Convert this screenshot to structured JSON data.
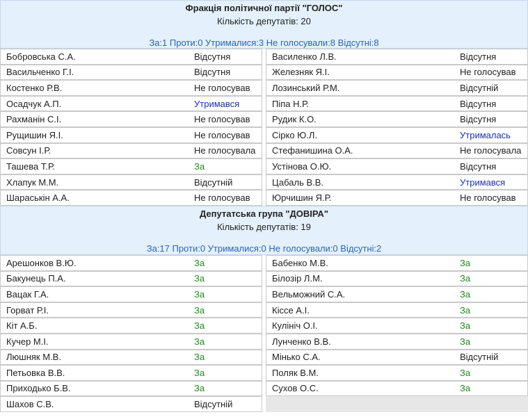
{
  "sections": [
    {
      "title": "Фракція політичної партії \"ГОЛОС\"",
      "count": "Кількість депутатів: 20",
      "summary": "За:1 Проти:0 Утрималися:3 Не голосували:8 Відсутні:8",
      "rows": [
        [
          {
            "name": "Бобровська С.А.",
            "status": "Відсутня",
            "kind": "other"
          },
          {
            "name": "Василенко Л.В.",
            "status": "Відсутня",
            "kind": "other"
          }
        ],
        [
          {
            "name": "Васильченко Г.І.",
            "status": "Відсутня",
            "kind": "other"
          },
          {
            "name": "Железняк Я.І.",
            "status": "Не голосував",
            "kind": "other"
          }
        ],
        [
          {
            "name": "Костенко Р.В.",
            "status": "Не голосував",
            "kind": "other"
          },
          {
            "name": "Лозинський Р.М.",
            "status": "Відсутній",
            "kind": "other"
          }
        ],
        [
          {
            "name": "Осадчук А.П.",
            "status": "Утримався",
            "kind": "utr"
          },
          {
            "name": "Піпа Н.Р.",
            "status": "Відсутня",
            "kind": "other"
          }
        ],
        [
          {
            "name": "Рахманін С.І.",
            "status": "Не голосував",
            "kind": "other"
          },
          {
            "name": "Рудик К.О.",
            "status": "Відсутня",
            "kind": "other"
          }
        ],
        [
          {
            "name": "Рущишин Я.І.",
            "status": "Не голосував",
            "kind": "other"
          },
          {
            "name": "Сірко Ю.Л.",
            "status": "Утрималась",
            "kind": "utr"
          }
        ],
        [
          {
            "name": "Совсун І.Р.",
            "status": "Не голосувала",
            "kind": "other"
          },
          {
            "name": "Стефанишина О.А.",
            "status": "Не голосувала",
            "kind": "other"
          }
        ],
        [
          {
            "name": "Ташева Т.Р.",
            "status": "За",
            "kind": "za"
          },
          {
            "name": "Устінова О.Ю.",
            "status": "Відсутня",
            "kind": "other"
          }
        ],
        [
          {
            "name": "Хлапук М.М.",
            "status": "Відсутній",
            "kind": "other"
          },
          {
            "name": "Цабаль В.В.",
            "status": "Утримався",
            "kind": "utr"
          }
        ],
        [
          {
            "name": "Шараськін А.А.",
            "status": "Не голосував",
            "kind": "other"
          },
          {
            "name": "Юрчишин Я.Р.",
            "status": "Не голосував",
            "kind": "other"
          }
        ]
      ]
    },
    {
      "title": "Депутатська група \"ДОВІРА\"",
      "count": "Кількість депутатів: 19",
      "summary": "За:17 Проти:0 Утрималися:0 Не голосували:0 Відсутні:2",
      "rows": [
        [
          {
            "name": "Арешонков В.Ю.",
            "status": "За",
            "kind": "za"
          },
          {
            "name": "Бабенко М.В.",
            "status": "За",
            "kind": "za"
          }
        ],
        [
          {
            "name": "Бакунець П.А.",
            "status": "За",
            "kind": "za"
          },
          {
            "name": "Білозір Л.М.",
            "status": "За",
            "kind": "za"
          }
        ],
        [
          {
            "name": "Вацак Г.А.",
            "status": "За",
            "kind": "za"
          },
          {
            "name": "Вельможний С.А.",
            "status": "За",
            "kind": "za"
          }
        ],
        [
          {
            "name": "Горват Р.І.",
            "status": "За",
            "kind": "za"
          },
          {
            "name": "Кіссе А.І.",
            "status": "За",
            "kind": "za"
          }
        ],
        [
          {
            "name": "Кіт А.Б.",
            "status": "За",
            "kind": "za"
          },
          {
            "name": "Кулініч О.І.",
            "status": "За",
            "kind": "za"
          }
        ],
        [
          {
            "name": "Кучер М.І.",
            "status": "За",
            "kind": "za"
          },
          {
            "name": "Лунченко В.В.",
            "status": "За",
            "kind": "za"
          }
        ],
        [
          {
            "name": "Люшняк М.В.",
            "status": "За",
            "kind": "za"
          },
          {
            "name": "Мінько С.А.",
            "status": "Відсутній",
            "kind": "other"
          }
        ],
        [
          {
            "name": "Петьовка В.В.",
            "status": "За",
            "kind": "za"
          },
          {
            "name": "Поляк В.М.",
            "status": "За",
            "kind": "za"
          }
        ],
        [
          {
            "name": "Приходько Б.В.",
            "status": "За",
            "kind": "za"
          },
          {
            "name": "Сухов О.С.",
            "status": "За",
            "kind": "za"
          }
        ],
        [
          {
            "name": "Шахов С.В.",
            "status": "Відсутній",
            "kind": "other"
          },
          null
        ]
      ]
    }
  ]
}
